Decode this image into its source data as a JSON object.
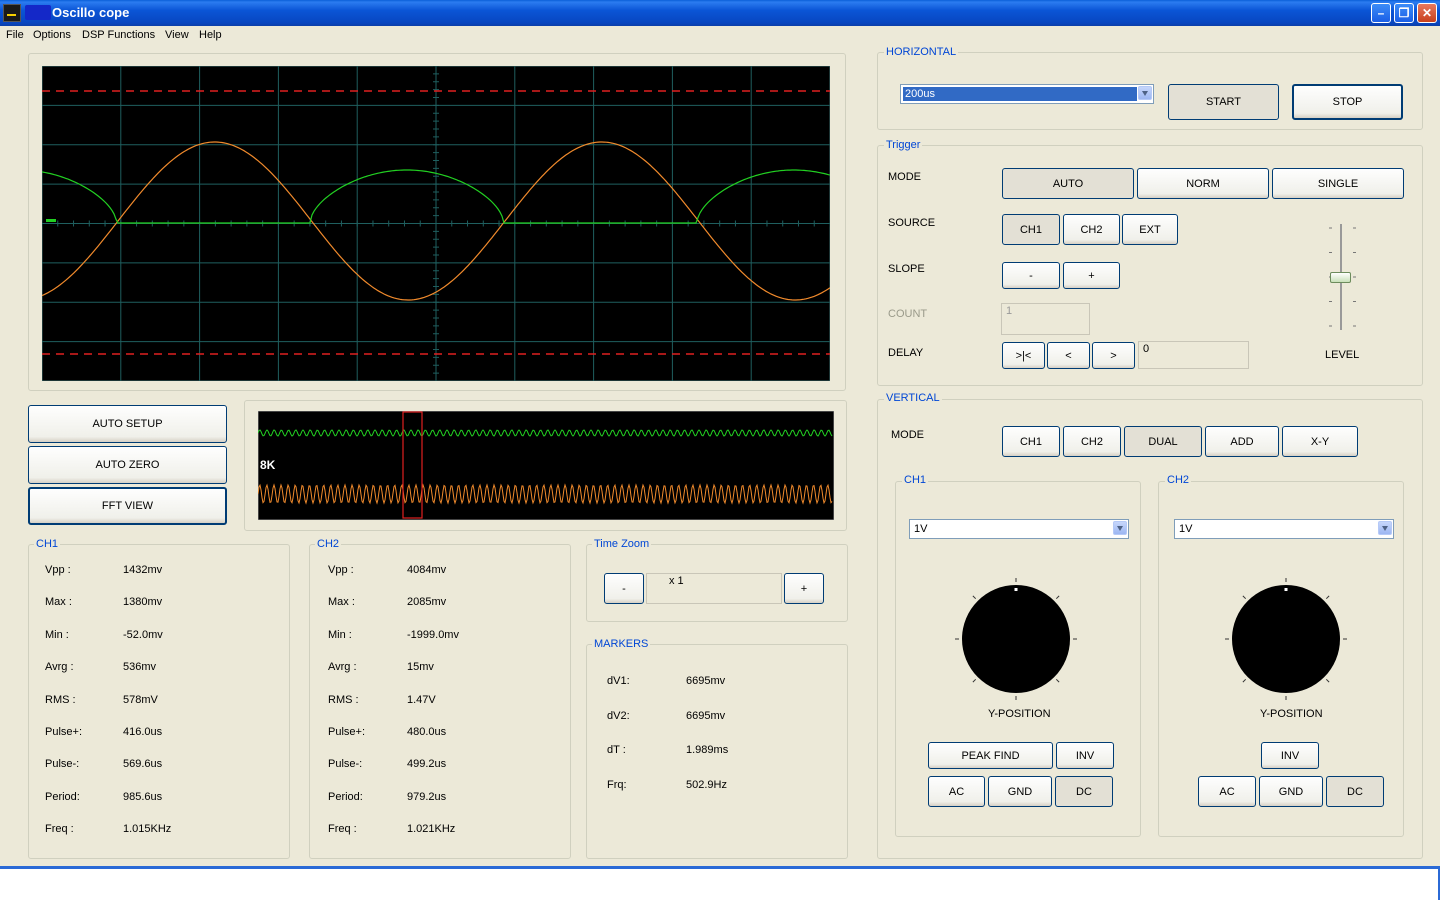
{
  "window": {
    "title": "Oscillo cope"
  },
  "menu": [
    "File",
    "Options",
    "DSP Functions",
    "View",
    "Help"
  ],
  "buttons_left": {
    "auto_setup": "AUTO SETUP",
    "auto_zero": "AUTO ZERO",
    "fft_view": "FFT  VIEW"
  },
  "overview": {
    "label": "8K"
  },
  "ch1_stats": {
    "title": "CH1",
    "rows": [
      {
        "label": "Vpp :",
        "value": "1432mv"
      },
      {
        "label": "Max :",
        "value": "1380mv"
      },
      {
        "label": "Min :",
        "value": "-52.0mv"
      },
      {
        "label": "Avrg :",
        "value": "536mv"
      },
      {
        "label": "RMS :",
        "value": "578mV"
      },
      {
        "label": "Pulse+:",
        "value": "416.0us"
      },
      {
        "label": "Pulse-:",
        "value": "569.6us"
      },
      {
        "label": "Period:",
        "value": "985.6us"
      },
      {
        "label": "Freq :",
        "value": "1.015KHz"
      }
    ]
  },
  "ch2_stats": {
    "title": "CH2",
    "rows": [
      {
        "label": "Vpp :",
        "value": "4084mv"
      },
      {
        "label": "Max :",
        "value": "2085mv"
      },
      {
        "label": "Min :",
        "value": "-1999.0mv"
      },
      {
        "label": "Avrg :",
        "value": "15mv"
      },
      {
        "label": "RMS :",
        "value": "1.47V"
      },
      {
        "label": "Pulse+:",
        "value": "480.0us"
      },
      {
        "label": "Pulse-:",
        "value": "499.2us"
      },
      {
        "label": "Period:",
        "value": "979.2us"
      },
      {
        "label": "Freq :",
        "value": "1.021KHz"
      }
    ]
  },
  "time_zoom": {
    "title": "Time Zoom",
    "minus": "-",
    "value": "x 1",
    "plus": "+"
  },
  "markers": {
    "title": "MARKERS",
    "rows": [
      {
        "label": "dV1:",
        "value": "6695mv"
      },
      {
        "label": "dV2:",
        "value": "6695mv"
      },
      {
        "label": "dT :",
        "value": "1.989ms"
      },
      {
        "label": "Frq:",
        "value": "502.9Hz"
      }
    ]
  },
  "horizontal": {
    "title": "HORIZONTAL",
    "timebase": "200us",
    "start": "START",
    "stop": "STOP"
  },
  "trigger": {
    "title": "Trigger",
    "mode_label": "MODE",
    "modes": [
      "AUTO",
      "NORM",
      "SINGLE"
    ],
    "source_label": "SOURCE",
    "sources": [
      "CH1",
      "CH2",
      "EXT"
    ],
    "slope_label": "SLOPE",
    "slope_minus": "-",
    "slope_plus": "+",
    "count_label": "COUNT",
    "count_value": "1",
    "delay_label": "DELAY",
    "delay_buttons": [
      ">|<",
      "<",
      ">"
    ],
    "delay_value": "0",
    "level_label": "LEVEL",
    "level_value": 0.5
  },
  "vertical": {
    "title": "VERTICAL",
    "mode_label": "MODE",
    "modes": [
      "CH1",
      "CH2",
      "DUAL",
      "ADD",
      "X-Y"
    ],
    "ch1": {
      "title": "CH1",
      "volts": "1V",
      "ypos_label": "Y-POSITION",
      "peak_find": "PEAK FIND",
      "inv": "INV",
      "ac": "AC",
      "gnd": "GND",
      "dc": "DC"
    },
    "ch2": {
      "title": "CH2",
      "volts": "1V",
      "ypos_label": "Y-POSITION",
      "inv": "INV",
      "ac": "AC",
      "gnd": "GND",
      "dc": "DC"
    }
  },
  "colors": {
    "ch1_trace": "#22d022",
    "ch2_trace": "#f08a2c",
    "grid": "#1f5f5f",
    "marker": "#e02020",
    "accent": "#0046d5"
  }
}
